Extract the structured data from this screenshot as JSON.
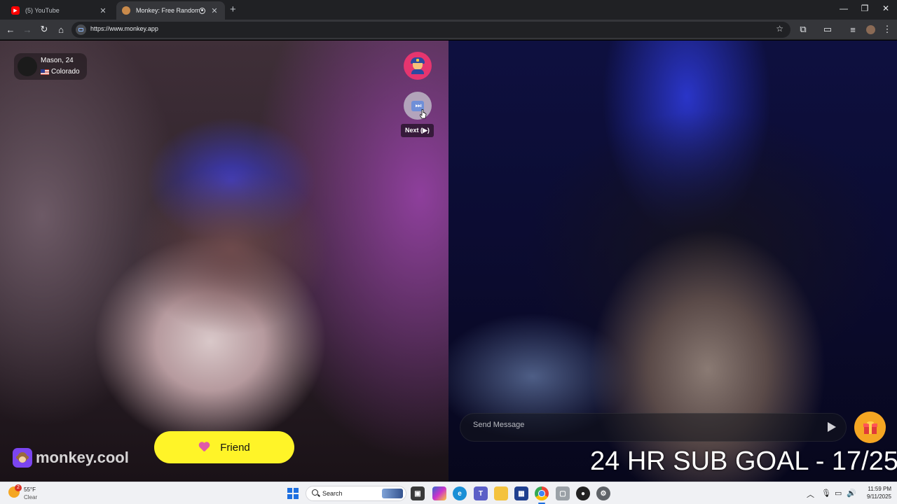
{
  "browser": {
    "tabs": [
      {
        "title": "(5) YouTube",
        "icon": "youtube-icon",
        "active": false
      },
      {
        "title": "Monkey: Free Random Vid",
        "icon": "monkey-favicon",
        "active": true
      }
    ],
    "url": "https://www.monkey.app"
  },
  "partner": {
    "name_age": "Mason, 24",
    "location": "Colorado",
    "flag": "us-flag-icon"
  },
  "controls": {
    "next_tooltip": "Next (▶)",
    "next_glyph": "⏭"
  },
  "brand": {
    "text": "monkey.cool"
  },
  "friend": {
    "label": "Friend"
  },
  "chat": {
    "placeholder": "Send Message"
  },
  "overlay": {
    "sub_goal": "24 HR SUB GOAL - 17/25"
  },
  "taskbar": {
    "weather_badge": "2",
    "weather_temp": "55°F",
    "weather_desc": "Clear",
    "search_label": "Search",
    "time": "11:59 PM",
    "date": "9/11/2025"
  },
  "colors": {
    "report_button": "#e6356f",
    "friend_button": "#fff428",
    "gift_button": "#f5a623",
    "brand_icon": "#7b45f0"
  }
}
